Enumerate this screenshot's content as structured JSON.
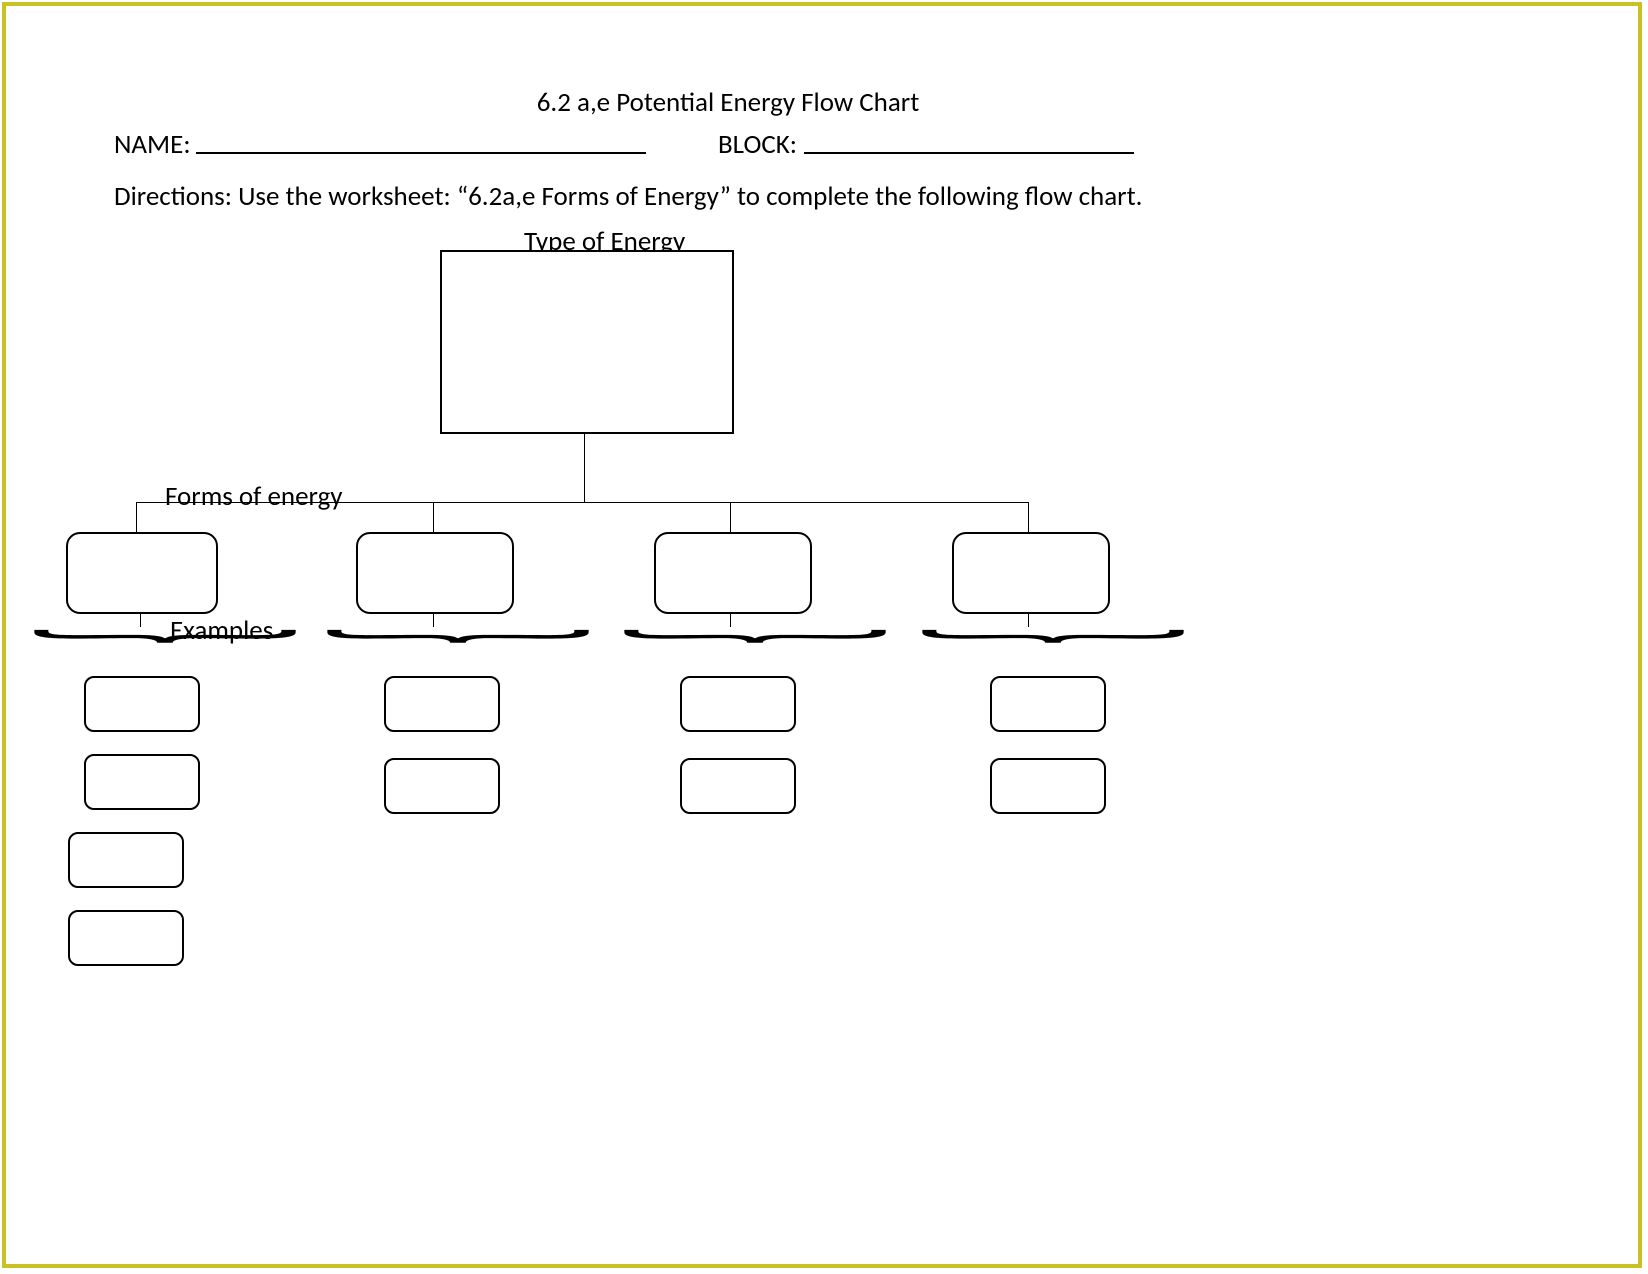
{
  "title": "6.2 a,e Potential Energy Flow Chart",
  "fields": {
    "name_label": "NAME:",
    "block_label": "BLOCK:"
  },
  "directions": "Directions: Use the worksheet:  “6.2a,e Forms of Energy”  to complete the following flow chart.",
  "chart_labels": {
    "top": "Type of Energy",
    "level2": "Forms of energy",
    "level3": "Examples"
  },
  "brace_glyph": "︸",
  "watermark": ""
}
